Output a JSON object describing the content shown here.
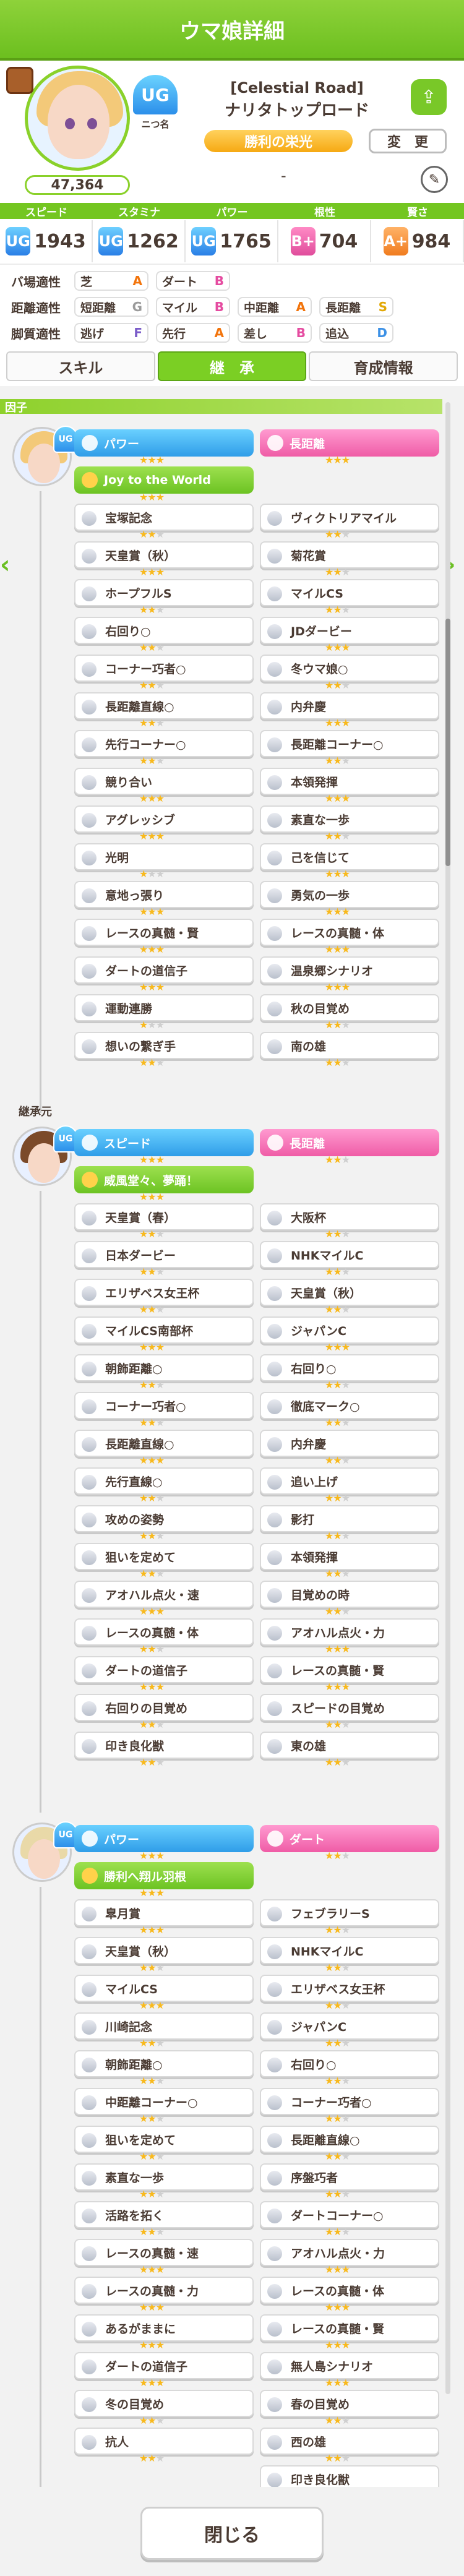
{
  "header": {
    "title": "ウマ娘詳細"
  },
  "profile": {
    "rank_label": "ニつ名",
    "rank_value": "UG",
    "title": "[Celestial Road]",
    "name": "ナリタトップロード",
    "epithet": "勝利の栄光",
    "change_label": "変　更",
    "evaluation": "47,364",
    "dash": "-"
  },
  "stats": {
    "labels": [
      "スピード",
      "スタミナ",
      "パワー",
      "根性",
      "賢さ"
    ],
    "grades": [
      "UG",
      "UG",
      "UG",
      "B+",
      "A+"
    ],
    "values": [
      "1943",
      "1262",
      "1765",
      "704",
      "984"
    ]
  },
  "aptitude": {
    "track_label": "バ場適性",
    "distance_label": "距離適性",
    "style_label": "脚質適性",
    "track": [
      {
        "name": "芝",
        "grade": "A"
      },
      {
        "name": "ダート",
        "grade": "B"
      }
    ],
    "distance": [
      {
        "name": "短距離",
        "grade": "G"
      },
      {
        "name": "マイル",
        "grade": "B"
      },
      {
        "name": "中距離",
        "grade": "A"
      },
      {
        "name": "長距離",
        "grade": "S"
      }
    ],
    "style": [
      {
        "name": "逃げ",
        "grade": "F"
      },
      {
        "name": "先行",
        "grade": "A"
      },
      {
        "name": "差し",
        "grade": "B"
      },
      {
        "name": "追込",
        "grade": "D"
      }
    ]
  },
  "tabs": [
    "スキル",
    "継　承",
    "育成情報"
  ],
  "section_self": "因子",
  "section_parents": "継承元",
  "self_factors": {
    "blue": {
      "label": "パワー",
      "stars": 3
    },
    "pink": {
      "label": "長距離",
      "stars": 3
    },
    "green": {
      "label": "Joy to the World",
      "stars": 3
    },
    "skills": [
      [
        "宝塚記念",
        2,
        "ヴィクトリアマイル",
        2
      ],
      [
        "天皇賞（秋）",
        3,
        "菊花賞",
        2
      ],
      [
        "ホープフルS",
        2,
        "マイルCS",
        2
      ],
      [
        "右回り○",
        2,
        "JDダービー",
        3
      ],
      [
        "コーナー巧者○",
        2,
        "冬ウマ娘○",
        2
      ],
      [
        "長距離直線○",
        2,
        "内弁慶",
        3
      ],
      [
        "先行コーナー○",
        2,
        "長距離コーナー○",
        2
      ],
      [
        "競り合い",
        3,
        "本領発揮",
        3
      ],
      [
        "アグレッシブ",
        3,
        "素直な一歩",
        2
      ],
      [
        "光明",
        1,
        "己を信じて",
        3
      ],
      [
        "意地っ張り",
        3,
        "勇気の一歩",
        3
      ],
      [
        "レースの真髄・賢",
        3,
        "レースの真髄・体",
        3
      ],
      [
        "ダートの道信子",
        3,
        "温泉郷シナリオ",
        3
      ],
      [
        "運動連勝",
        1,
        "秋の目覚め",
        2
      ],
      [
        "想いの繋ぎ手",
        2,
        "南の雄",
        2
      ]
    ]
  },
  "parent1": {
    "blue": {
      "label": "スピード",
      "stars": 3
    },
    "pink": {
      "label": "長距離",
      "stars": 2
    },
    "green": {
      "label": "威風堂々、夢踊！",
      "stars": 3
    },
    "skills": [
      [
        "天皇賞（春）",
        2,
        "大阪杯",
        2
      ],
      [
        "日本ダービー",
        2,
        "NHKマイルC",
        2
      ],
      [
        "エリザベス女王杯",
        2,
        "天皇賞（秋）",
        2
      ],
      [
        "マイルCS南部杯",
        3,
        "ジャパンC",
        3
      ],
      [
        "朝飾距離○",
        2,
        "右回り○",
        2
      ],
      [
        "コーナー巧者○",
        2,
        "徹底マーク○",
        2
      ],
      [
        "長距離直線○",
        3,
        "内弁慶",
        2
      ],
      [
        "先行直線○",
        2,
        "追い上げ",
        2
      ],
      [
        "攻めの姿勢",
        2,
        "影打",
        2
      ],
      [
        "狙いを定めて",
        2,
        "本領発揮",
        2
      ],
      [
        "アオハル点火・速",
        3,
        "目覚めの時",
        2
      ],
      [
        "レースの真髄・体",
        2,
        "アオハル点火・力",
        3
      ],
      [
        "ダートの道信子",
        3,
        "レースの真髄・賢",
        3
      ],
      [
        "右回りの目覚め",
        2,
        "スピードの目覚め",
        2
      ],
      [
        "印き良化獣",
        2,
        "東の雄",
        2
      ]
    ]
  },
  "parent2": {
    "blue": {
      "label": "パワー",
      "stars": 3
    },
    "pink": {
      "label": "ダート",
      "stars": 2
    },
    "green": {
      "label": "勝利へ翔ル羽根",
      "stars": 3
    },
    "skills": [
      [
        "皐月賞",
        3,
        "フェブラリーS",
        2
      ],
      [
        "天皇賞（秋）",
        2,
        "NHKマイルC",
        2
      ],
      [
        "マイルCS",
        3,
        "エリザベス女王杯",
        2
      ],
      [
        "川崎記念",
        2,
        "ジャパンC",
        2
      ],
      [
        "朝飾距離○",
        2,
        "右回り○",
        2
      ],
      [
        "中距離コーナー○",
        2,
        "コーナー巧者○",
        2
      ],
      [
        "狙いを定めて",
        2,
        "長距離直線○",
        2
      ],
      [
        "素直な一歩",
        2,
        "序盤巧者",
        2
      ],
      [
        "活路を拓く",
        2,
        "ダートコーナー○",
        2
      ],
      [
        "レースの真髄・速",
        3,
        "アオハル点火・力",
        3
      ],
      [
        "レースの真髄・力",
        3,
        "レースの真髄・体",
        3
      ],
      [
        "あるがままに",
        3,
        "レースの真髄・賢",
        3
      ],
      [
        "ダートの道信子",
        3,
        "無人島シナリオ",
        3
      ],
      [
        "冬の目覚め",
        2,
        "春の目覚め",
        2
      ],
      [
        "抗人",
        2,
        "西の雄",
        2
      ],
      [
        "",
        0,
        "印き良化獣",
        2
      ]
    ]
  },
  "close_label": "閉じる"
}
